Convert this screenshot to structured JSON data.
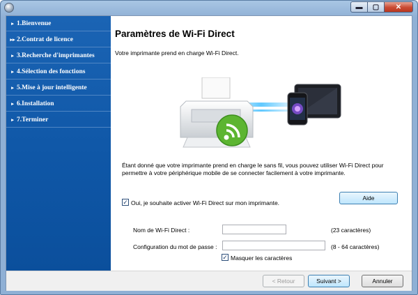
{
  "window": {
    "buttons": {
      "minimize": "▬",
      "maximize": "▢",
      "close": "✕"
    }
  },
  "sidebar": {
    "items": [
      {
        "label": "1.Bienvenue",
        "marker": "▸"
      },
      {
        "label": "2.Contrat de licence",
        "marker": "▸▸"
      },
      {
        "label": "3.Recherche d'imprimantes",
        "marker": "▸"
      },
      {
        "label": "4.Sélection des fonctions",
        "marker": "▸"
      },
      {
        "label": "5.Mise à jour intelligente",
        "marker": "▸"
      },
      {
        "label": "6.Installation",
        "marker": "▸"
      },
      {
        "label": "7.Terminer",
        "marker": "▸"
      }
    ]
  },
  "main": {
    "title": "Paramètres de Wi-Fi Direct",
    "subtitle": "Votre imprimante prend en charge Wi-Fi Direct.",
    "description": "Étant donné que votre imprimante prend en charge le sans fil, vous pouvez utiliser Wi-Fi Direct pour permettre à votre périphérique mobile de se connecter facilement à votre imprimante.",
    "enable_checkbox": {
      "label": "Oui, je souhaite activer Wi-Fi Direct sur mon imprimante.",
      "checked": true,
      "mark": "✓"
    },
    "help_button": "Aide",
    "wifi_name": {
      "label": "Nom de Wi-Fi Direct :",
      "value": "",
      "hint": "(23 caractères)"
    },
    "password": {
      "label": "Configuration du mot de passe :",
      "value": "",
      "hint": "(8 - 64 caractères)"
    },
    "mask_checkbox": {
      "label": "Masquer les caractères",
      "checked": true,
      "mark": "✓"
    }
  },
  "footer": {
    "back": "< Retour",
    "next": "Suivant >",
    "cancel": "Annuler"
  },
  "colors": {
    "sidebar": "#1560b0",
    "wifi_green": "#5cb531",
    "beam_blue": "#4fc3ff"
  }
}
